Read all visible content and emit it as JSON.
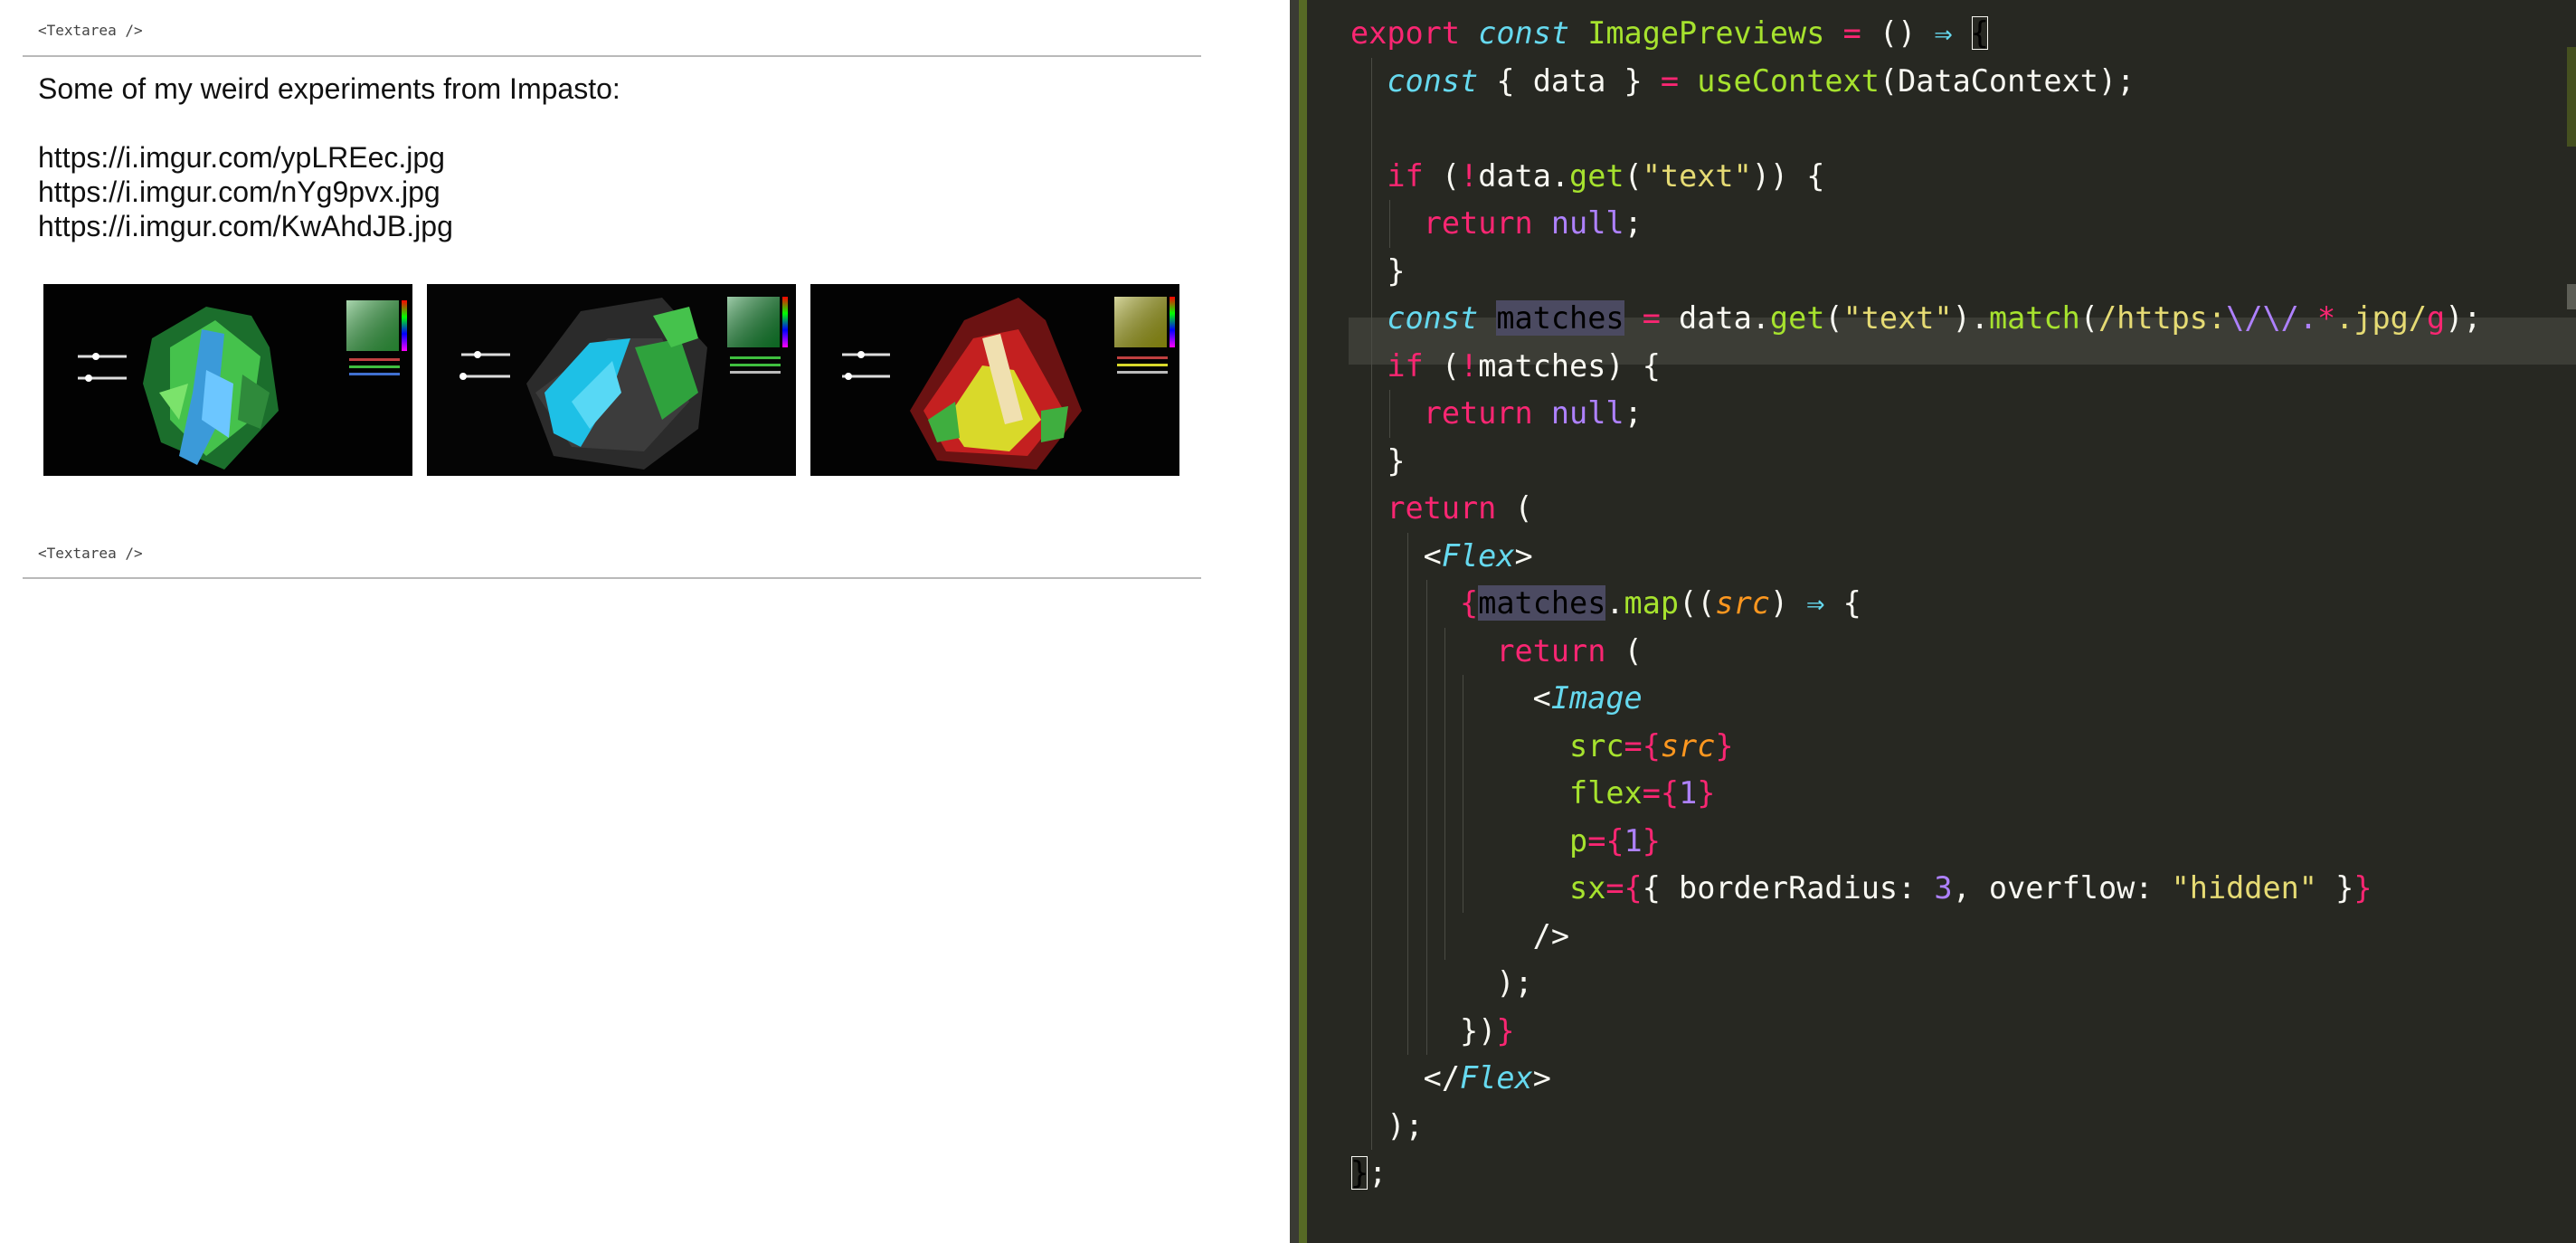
{
  "left": {
    "top_label": "<Textarea />",
    "bottom_label": "<Textarea />",
    "text_lines": [
      "Some of my weird experiments from Impasto:",
      "",
      "https://i.imgur.com/ypLREec.jpg",
      "https://i.imgur.com/nYg9pvx.jpg",
      "https://i.imgur.com/KwAhdJB.jpg"
    ],
    "previews": [
      {
        "name": "image-preview-ypLREec",
        "palette": "green-blue"
      },
      {
        "name": "image-preview-nYg9pvx",
        "palette": "cyan-dark"
      },
      {
        "name": "image-preview-KwAhdJB",
        "palette": "red-yellow"
      }
    ]
  },
  "editor": {
    "theme_colors": {
      "background": "#272822",
      "keyword": "#f92672",
      "storage": "#66d9ef",
      "function": "#a6e22e",
      "string": "#e6db74",
      "number": "#ae81ff",
      "parameter": "#fd971f",
      "text": "#f8f8f2"
    },
    "code_lines": [
      [
        [
          "k",
          "export"
        ],
        [
          "pl",
          " "
        ],
        [
          "st",
          "const"
        ],
        [
          "pl",
          " "
        ],
        [
          "fn",
          "ImagePreviews"
        ],
        [
          "pl",
          " "
        ],
        [
          "o",
          "="
        ],
        [
          "pl",
          " () "
        ],
        [
          "ar",
          "⇒"
        ],
        [
          "pl",
          " "
        ],
        [
          "cur",
          "{"
        ]
      ],
      [
        [
          "pl",
          "  "
        ],
        [
          "st",
          "const"
        ],
        [
          "pl",
          " { data } "
        ],
        [
          "o",
          "="
        ],
        [
          "pl",
          " "
        ],
        [
          "fn",
          "useContext"
        ],
        [
          "pl",
          "(DataContext);"
        ]
      ],
      [],
      [
        [
          "pl",
          "  "
        ],
        [
          "k",
          "if"
        ],
        [
          "pl",
          " ("
        ],
        [
          "o",
          "!"
        ],
        [
          "pl",
          "data."
        ],
        [
          "fn",
          "get"
        ],
        [
          "pl",
          "("
        ],
        [
          "s",
          "\"text\""
        ],
        [
          "pl",
          ")) {"
        ]
      ],
      [
        [
          "pl",
          "    "
        ],
        [
          "k",
          "return"
        ],
        [
          "pl",
          " "
        ],
        [
          "n",
          "null"
        ],
        [
          "pl",
          ";"
        ]
      ],
      [
        [
          "pl",
          "  }"
        ]
      ],
      [
        [
          "pl",
          "  "
        ],
        [
          "st",
          "const"
        ],
        [
          "pl",
          " "
        ],
        [
          "sel",
          "matches"
        ],
        [
          "pl",
          " "
        ],
        [
          "o",
          "="
        ],
        [
          "pl",
          " data."
        ],
        [
          "fn",
          "get"
        ],
        [
          "pl",
          "("
        ],
        [
          "s",
          "\"text\""
        ],
        [
          "pl",
          ")."
        ],
        [
          "fn",
          "match"
        ],
        [
          "pl",
          "("
        ],
        [
          "s",
          "/https:"
        ],
        [
          "n",
          "\\/\\/."
        ],
        [
          "o",
          "*"
        ],
        [
          "s",
          ".jpg/"
        ],
        [
          "k",
          "g"
        ],
        [
          "pl",
          ");"
        ]
      ],
      [
        [
          "pl",
          "  "
        ],
        [
          "k",
          "if"
        ],
        [
          "pl",
          " ("
        ],
        [
          "o",
          "!"
        ],
        [
          "pl",
          "matches) {"
        ]
      ],
      [
        [
          "pl",
          "    "
        ],
        [
          "k",
          "return"
        ],
        [
          "pl",
          " "
        ],
        [
          "n",
          "null"
        ],
        [
          "pl",
          ";"
        ]
      ],
      [
        [
          "pl",
          "  }"
        ]
      ],
      [
        [
          "pl",
          "  "
        ],
        [
          "k",
          "return"
        ],
        [
          "pl",
          " ("
        ]
      ],
      [
        [
          "pl",
          "    <"
        ],
        [
          "ti",
          "Flex"
        ],
        [
          "pl",
          ">"
        ]
      ],
      [
        [
          "pl",
          "      "
        ],
        [
          "k",
          "{"
        ],
        [
          "sel",
          "matches"
        ],
        [
          "pl",
          "."
        ],
        [
          "fn",
          "map"
        ],
        [
          "pl",
          "(("
        ],
        [
          "pa",
          "src"
        ],
        [
          "pl",
          ") "
        ],
        [
          "ar",
          "⇒"
        ],
        [
          "pl",
          " {"
        ]
      ],
      [
        [
          "pl",
          "        "
        ],
        [
          "k",
          "return"
        ],
        [
          "pl",
          " ("
        ]
      ],
      [
        [
          "pl",
          "          <"
        ],
        [
          "ti",
          "Image"
        ]
      ],
      [
        [
          "pl",
          "            "
        ],
        [
          "fn",
          "src"
        ],
        [
          "o",
          "="
        ],
        [
          "k",
          "{"
        ],
        [
          "pa",
          "src"
        ],
        [
          "k",
          "}"
        ]
      ],
      [
        [
          "pl",
          "            "
        ],
        [
          "fn",
          "flex"
        ],
        [
          "o",
          "="
        ],
        [
          "k",
          "{"
        ],
        [
          "n",
          "1"
        ],
        [
          "k",
          "}"
        ]
      ],
      [
        [
          "pl",
          "            "
        ],
        [
          "fn",
          "p"
        ],
        [
          "o",
          "="
        ],
        [
          "k",
          "{"
        ],
        [
          "n",
          "1"
        ],
        [
          "k",
          "}"
        ]
      ],
      [
        [
          "pl",
          "            "
        ],
        [
          "fn",
          "sx"
        ],
        [
          "o",
          "="
        ],
        [
          "k",
          "{"
        ],
        [
          "pl",
          "{ borderRadius: "
        ],
        [
          "n",
          "3"
        ],
        [
          "pl",
          ", overflow: "
        ],
        [
          "s",
          "\"hidden\""
        ],
        [
          "pl",
          " }"
        ],
        [
          "k",
          "}"
        ]
      ],
      [
        [
          "pl",
          "          />"
        ]
      ],
      [
        [
          "pl",
          "        );"
        ]
      ],
      [
        [
          "pl",
          "      })"
        ],
        [
          "k",
          "}"
        ]
      ],
      [
        [
          "pl",
          "    </"
        ],
        [
          "ti",
          "Flex"
        ],
        [
          "pl",
          ">"
        ]
      ],
      [
        [
          "pl",
          "  );"
        ]
      ],
      [
        [
          "cur",
          "}"
        ],
        [
          "pl",
          ";"
        ]
      ]
    ]
  }
}
